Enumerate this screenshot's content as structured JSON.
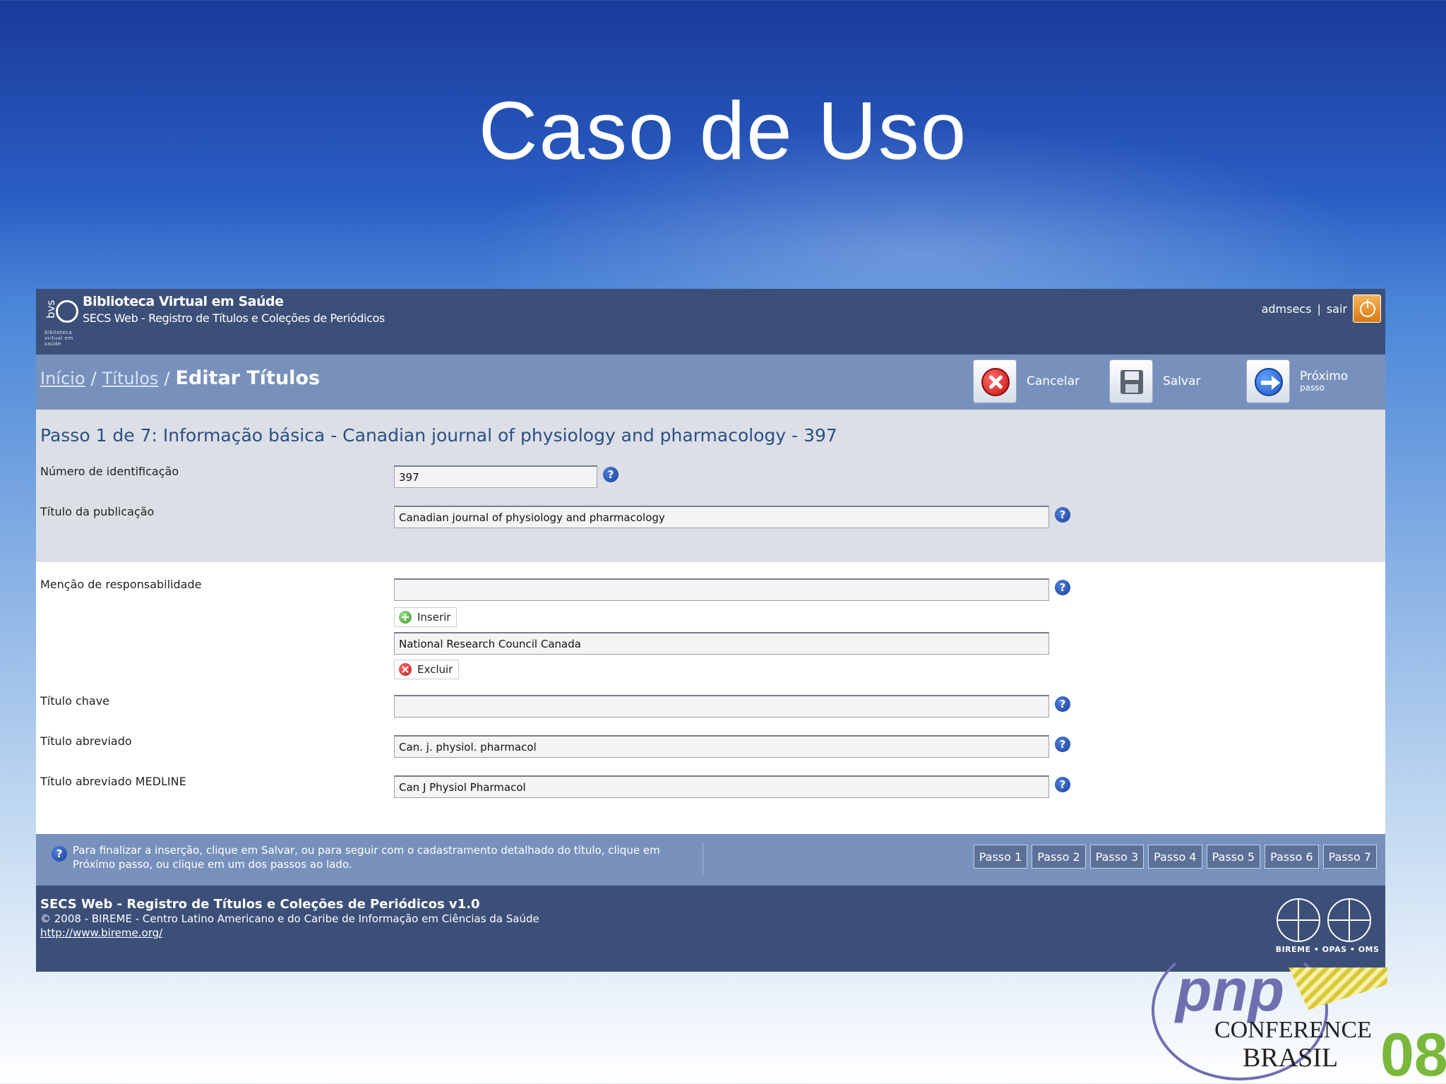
{
  "slide": {
    "title": "Caso de Uso"
  },
  "header": {
    "logo_text": "bvs",
    "logo_caption": "biblioteca virtual em saúde",
    "brand_title": "Biblioteca Virtual em Saúde",
    "brand_subtitle": "SECS Web - Registro de Títulos e Coleções de Periódicos",
    "user": "admsecs",
    "separator": "|",
    "logout_label": "sair"
  },
  "toolbar": {
    "breadcrumb": {
      "home": "Início",
      "titles": "Títulos",
      "separator": "/",
      "current": "Editar Títulos"
    },
    "cancel_label": "Cancelar",
    "save_label": "Salvar",
    "next_label": "Próximo",
    "next_sub": "passo"
  },
  "form": {
    "step_heading": "Passo 1 de 7: Informação básica - Canadian journal of physiology and pharmacology - 397",
    "help_symbol": "?",
    "id_number": {
      "label": "Número de identificação",
      "value": "397"
    },
    "publication_title": {
      "label": "Título da publicação",
      "value": "Canadian journal of physiology and pharmacology"
    },
    "responsibility": {
      "label": "Menção de responsabilidade",
      "value": "",
      "insert_label": "Inserir",
      "entries": [
        "National Research Council Canada"
      ],
      "delete_label": "Excluir"
    },
    "key_title": {
      "label": "Título chave",
      "value": ""
    },
    "abbrev_title": {
      "label": "Título abreviado",
      "value": "Can. j. physiol. pharmacol"
    },
    "medline_title": {
      "label": "Título abreviado MEDLINE",
      "value": "Can J Physiol Pharmacol"
    }
  },
  "info_bar": {
    "text_line1": "Para finalizar a inserção, clique em Salvar, ou para seguir com o cadastramento detalhado do título, clique em",
    "text_line2": "Próximo passo, ou clique em um dos passos ao lado.",
    "steps": [
      "Passo 1",
      "Passo 2",
      "Passo 3",
      "Passo 4",
      "Passo 5",
      "Passo 6",
      "Passo 7"
    ]
  },
  "footer": {
    "title": "SECS Web - Registro de Títulos e Coleções de Periódicos v1.0",
    "copyright": "© 2008 - BIREME - Centro Latino Americano e do Caribe de Informação em Ciências da Saúde",
    "link": "http://www.bireme.org/",
    "partners": "BIREME • OPAS • OMS"
  },
  "conference": {
    "logo_text": "pnp",
    "line1": "CONFERENCE",
    "line2": "BRASIL",
    "year": "08"
  }
}
